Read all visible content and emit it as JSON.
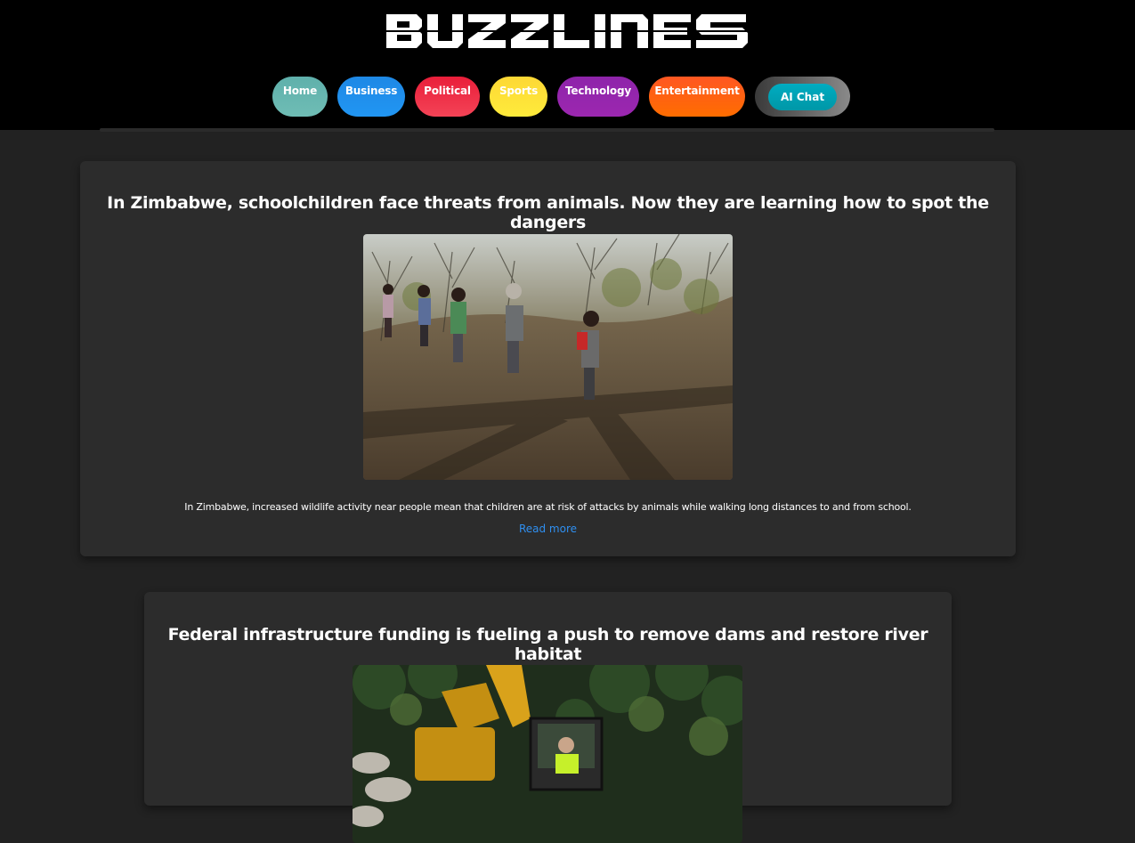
{
  "site": {
    "logo_text": "BUZZLINES"
  },
  "nav": {
    "items": [
      {
        "label": "Home",
        "color": "#68b6b0"
      },
      {
        "label": "Business",
        "color": "#2196f3"
      },
      {
        "label": "Political",
        "color": "#f0334d"
      },
      {
        "label": "Sports",
        "color": "#fde23a"
      },
      {
        "label": "Technology",
        "color": "#9c27b0"
      },
      {
        "label": "Entertainment",
        "color": "#ff6010"
      }
    ],
    "ai_chat": {
      "label": "AI Chat",
      "color": "#00a8bd"
    }
  },
  "articles": [
    {
      "title": "In Zimbabwe, schoolchildren face threats from animals. Now they are learning how to spot the dangers",
      "image_alt": "schoolchildren walking along a dirt path through dry bush",
      "caption": "In Zimbabwe, increased wildlife activity near people mean that children are at risk of attacks by animals while walking long distances to and from school.",
      "link_label": "Read more"
    },
    {
      "title": "Federal infrastructure funding is fueling a push to remove dams and restore river habitat",
      "image_alt": "excavator operator working among rocks and trees"
    }
  ],
  "colors": {
    "page_bg": "#222222",
    "header_bg": "#000000",
    "card_bg": "#2c2c2c",
    "link": "#2f8ff0"
  }
}
